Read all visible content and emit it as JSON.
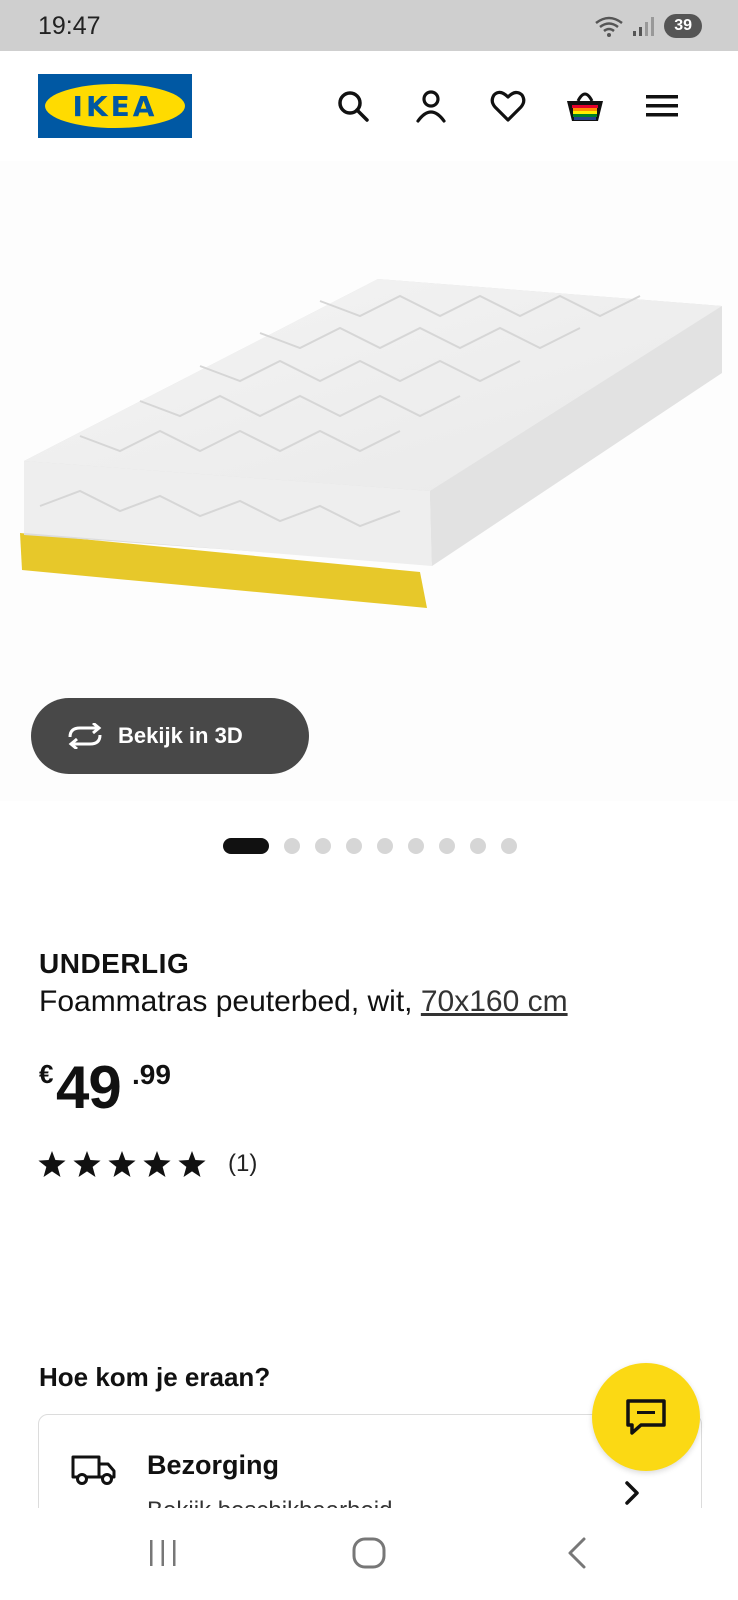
{
  "status_bar": {
    "time": "19:47",
    "battery": "39"
  },
  "header": {
    "logo": "IKEA"
  },
  "gallery": {
    "view_3d_label": "Bekijk in 3D",
    "total_images": 10,
    "active_index": 0
  },
  "product": {
    "name": "UNDERLIG",
    "description": "Foammatras peuterbed, wit,",
    "size": "70x160 cm",
    "price": {
      "currency": "€",
      "integer": "49",
      "decimal": ".99"
    },
    "rating": {
      "stars": 5,
      "max": 5,
      "count": "(1)"
    }
  },
  "delivery": {
    "section_title": "Hoe kom je eraan?",
    "card_title": "Bezorging",
    "card_subtitle": "Bekijk beschikbaarheid"
  },
  "colors": {
    "ikea_blue": "#0058a3",
    "ikea_yellow": "#ffdb00",
    "fab_yellow": "#fbd914"
  }
}
